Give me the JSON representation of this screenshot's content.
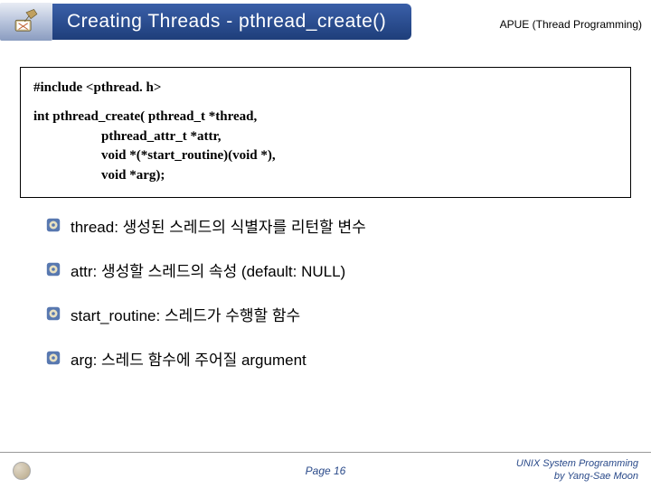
{
  "header": {
    "title": "Creating Threads - pthread_create()",
    "apue": "APUE (Thread Programming)"
  },
  "code": {
    "include": "#include <pthread. h>",
    "signature": "int pthread_create( pthread_t *thread,\n                    pthread_attr_t *attr,\n                    void *(*start_routine)(void *),\n                    void *arg);"
  },
  "bullets": [
    {
      "text": "thread: 생성된 스레드의 식별자를 리턴할 변수"
    },
    {
      "text": "attr: 생성할 스레드의 속성 (default: NULL)"
    },
    {
      "text": "start_routine: 스레드가 수행할 함수"
    },
    {
      "text": "arg: 스레드 함수에 주어질 argument"
    }
  ],
  "footer": {
    "page": "Page 16",
    "right1": "UNIX System Programming",
    "right2": "by Yang-Sae Moon"
  }
}
